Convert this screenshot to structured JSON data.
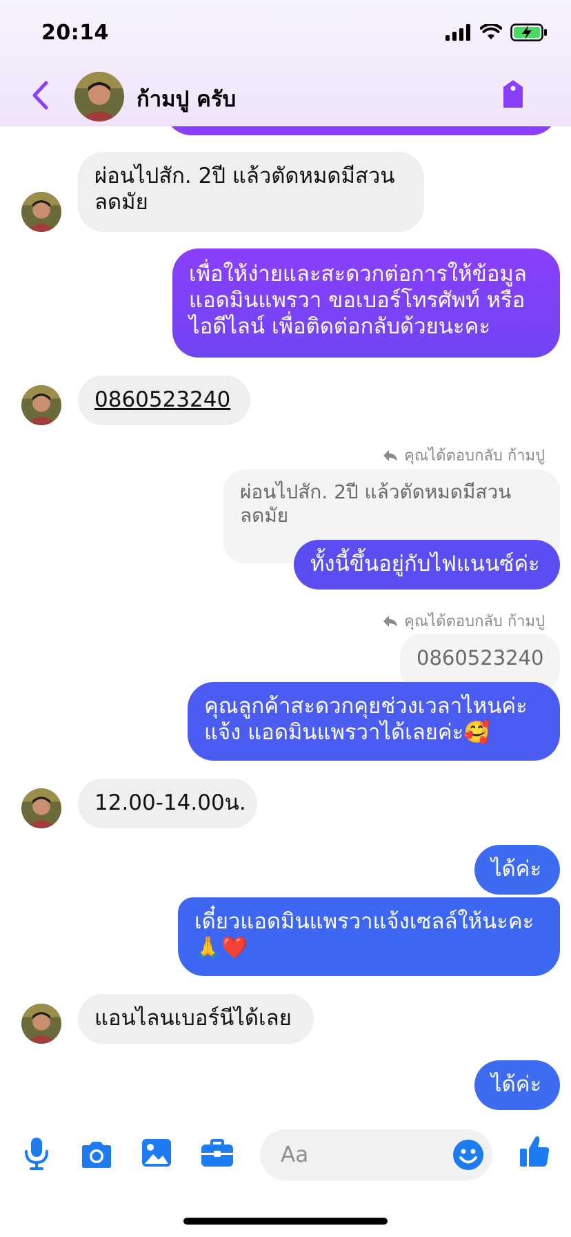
{
  "status_bar": {
    "time": "20:14"
  },
  "header": {
    "contact_name": "ก้ามปู ครับ"
  },
  "colors": {
    "accent": "#8a3ffc",
    "bubble_purple": "#7b3ff2",
    "bubble_blue": "#3d6cf3",
    "incoming_bg": "#efefef"
  },
  "messages": [
    {
      "sender": "contact",
      "lines": [
        "ผ่อนไปสัก. 2ปี แล้วตัดหมดมีสวน",
        "ลดมัย"
      ]
    },
    {
      "sender": "me",
      "lines": [
        "เพื่อให้ง่ายและสะดวกต่อการให้ข้อมูล",
        "แอดมินแพรวา ขอเบอร์โทรศัพท์ หรือ",
        "ไอดีไลน์ เพื่อติดต่อกลับด้วยนะคะ"
      ]
    },
    {
      "sender": "contact",
      "lines": [
        "0860523240"
      ]
    },
    {
      "sender": "me",
      "reply_label": "คุณได้ตอบกลับ ก้ามปู",
      "quoted": [
        "ผ่อนไปสัก. 2ปี แล้วตัดหมดมีสวน",
        "ลดมัย"
      ],
      "lines": [
        "ทั้งนี้ขึ้นอยู่กับไฟแนนซ์ค่ะ"
      ]
    },
    {
      "sender": "me",
      "reply_label": "คุณได้ตอบกลับ ก้ามปู",
      "quoted": [
        "0860523240"
      ],
      "lines": [
        "คุณลูกค้าสะดวกคุยช่วงเวลาไหนค่ะ",
        "แจ้ง แอดมินแพรวาได้เลยค่ะ🥰"
      ]
    },
    {
      "sender": "contact",
      "lines": [
        "12.00-14.00น."
      ]
    },
    {
      "sender": "me",
      "lines": [
        "ได้ค่ะ"
      ]
    },
    {
      "sender": "me",
      "lines": [
        "เดี๋ยวแอดมินแพรวาแจ้งเซลล์ให้นะคะ",
        "🙏❤️"
      ]
    },
    {
      "sender": "contact",
      "lines": [
        "แอนไลนเบอร์นีได้เลย"
      ]
    },
    {
      "sender": "me",
      "lines": [
        "ได้ค่ะ"
      ]
    }
  ],
  "composer": {
    "placeholder": "Aa",
    "icons": [
      "microphone-icon",
      "camera-icon",
      "gallery-icon",
      "toolbox-icon",
      "emoji-icon",
      "thumbs-up-icon"
    ]
  }
}
